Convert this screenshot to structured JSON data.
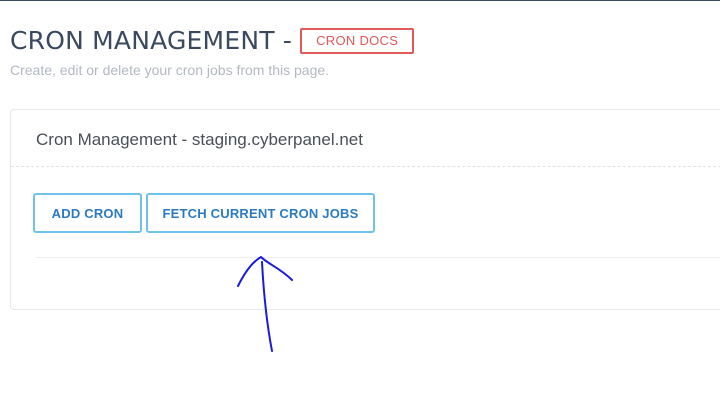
{
  "header": {
    "title": "CRON MANAGEMENT -",
    "docs_label": "CRON DOCS",
    "subtitle": "Create, edit or delete your cron jobs from this page."
  },
  "panel": {
    "title": "Cron Management - staging.cyberpanel.net",
    "add_label": "ADD CRON",
    "fetch_label": "FETCH CURRENT CRON JOBS"
  },
  "annotation": {
    "icon": "hand-drawn-arrow-icon",
    "color": "#1a1adb"
  },
  "colors": {
    "docs_accent": "#e05a5a",
    "button_border": "#6fc3ea",
    "button_text": "#2c7bbf"
  }
}
